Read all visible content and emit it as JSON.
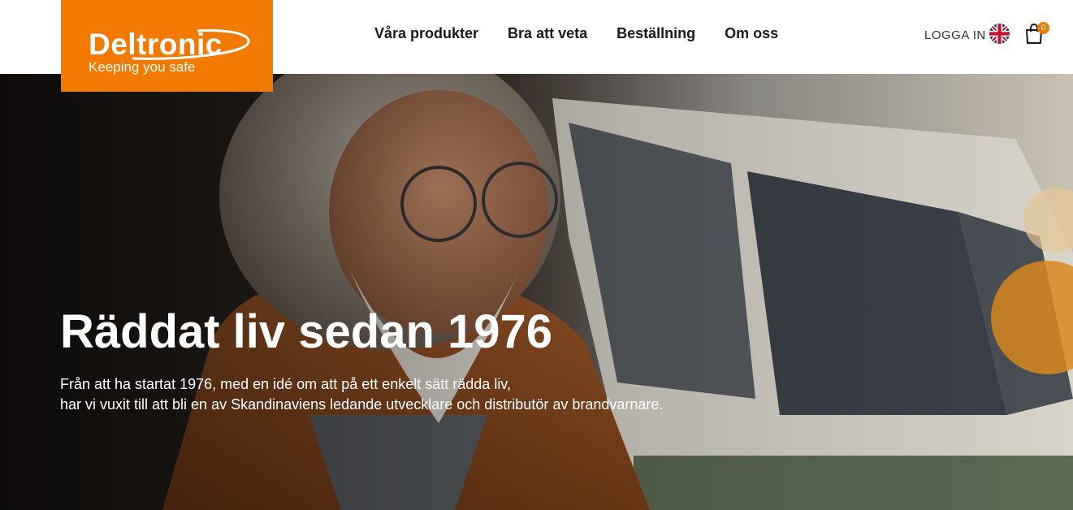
{
  "logo": {
    "name": "Deltronic",
    "tagline": "Keeping you safe"
  },
  "nav": [
    "Våra produkter",
    "Bra att veta",
    "Beställning",
    "Om oss"
  ],
  "header": {
    "login": "LOGGA IN",
    "cart_count": "0",
    "language_icon": "uk-flag-icon",
    "cart_icon": "shopping-bag-icon"
  },
  "hero": {
    "title": "Räddat liv sedan 1976",
    "text_line1": "Från att ha startat 1976, med en idé om att på ett enkelt sätt rädda liv,",
    "text_line2": "har vi vuxit till att bli en av Skandinaviens ledande utvecklare och distributör av brandvarnare."
  },
  "colors": {
    "brand": "#F27A00",
    "hero_dark": "#2b2420"
  }
}
